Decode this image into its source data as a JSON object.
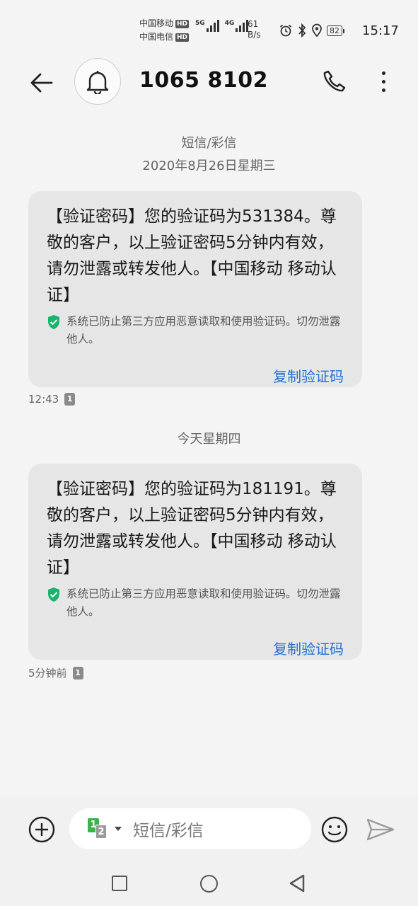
{
  "status_bar": {
    "carrier_1": "中国移动",
    "carrier_2": "中国电信",
    "hd_label": "HD",
    "network_1": "5G",
    "network_2": "4G",
    "speed_value": "61",
    "speed_unit": "B/s",
    "battery": "82",
    "time": "15:17",
    "icons": [
      "alarm-icon",
      "bluetooth-icon",
      "location-icon"
    ]
  },
  "header": {
    "back_icon": "arrow-left-icon",
    "avatar_icon": "bell-icon",
    "contact": "1065 8102",
    "call_icon": "phone-icon",
    "more_icon": "more-vertical-icon"
  },
  "thread": {
    "type_label": "短信/彩信",
    "date_1": "2020年8月26日星期三",
    "date_2": "今天星期四",
    "messages": [
      {
        "text": "【验证密码】您的验证码为531384。尊敬的客户，以上验证密码5分钟内有效，请勿泄露或转发他人。【中国移动 移动认证】",
        "security_note": "系统已防止第三方应用恶意读取和使用验证码。切勿泄露他人。",
        "copy_label": "复制验证码",
        "time": "12:43",
        "sim": "1"
      },
      {
        "text": "【验证密码】您的验证码为181191。尊敬的客户，以上验证密码5分钟内有效，请勿泄露或转发他人。【中国移动 移动认证】",
        "security_note": "系统已防止第三方应用恶意读取和使用验证码。切勿泄露他人。",
        "copy_label": "复制验证码",
        "time": "5分钟前",
        "sim": "1"
      }
    ]
  },
  "composer": {
    "sim_1": "1",
    "sim_2": "2",
    "placeholder": "短信/彩信",
    "icons": [
      "add-circle-icon",
      "emoji-icon",
      "send-icon"
    ]
  },
  "colors": {
    "accent": "#1f6fd6",
    "bubble": "#e6e6e6",
    "shield": "#19b36b",
    "sim_green": "#3bb34a"
  }
}
